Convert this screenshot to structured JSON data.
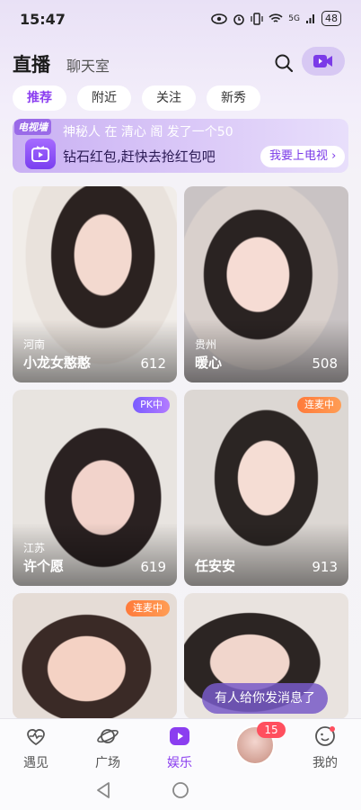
{
  "status_bar": {
    "time": "15:47",
    "battery": "48",
    "signal_label": "5G"
  },
  "header": {
    "title": "直播",
    "tab_chat": "聊天室"
  },
  "chips": [
    {
      "label": "推荐",
      "active": true
    },
    {
      "label": "附近",
      "active": false
    },
    {
      "label": "关注",
      "active": false
    },
    {
      "label": "新秀",
      "active": false
    }
  ],
  "banner": {
    "tag": "电视墙",
    "line1": "神秘人 在 清心 阁 发了一个50",
    "line2": "钻石红包,赶快去抢红包吧",
    "cta": "我要上电视"
  },
  "cards": [
    {
      "region": "河南",
      "name": "小龙女憨憨",
      "count": "612",
      "badge": ""
    },
    {
      "region": "贵州",
      "name": "暖心",
      "count": "508",
      "badge": ""
    },
    {
      "region": "江苏",
      "name": "许个愿",
      "count": "619",
      "badge": "PK中"
    },
    {
      "region": "",
      "name": "任安安",
      "count": "913",
      "badge": "连麦中"
    },
    {
      "region": "",
      "name": "",
      "count": "",
      "badge": "连麦中"
    },
    {
      "region": "",
      "name": "",
      "count": "",
      "badge": ""
    }
  ],
  "toast": "有人给你发消息了",
  "tabbar": {
    "tabs": [
      {
        "label": "遇见",
        "icon": "heart-pulse-icon"
      },
      {
        "label": "广场",
        "icon": "planet-icon"
      },
      {
        "label": "娱乐",
        "icon": "play-icon",
        "active": true
      },
      {
        "label": "我的",
        "icon": "smile-icon"
      }
    ],
    "message_count": "15"
  },
  "colors": {
    "accent": "#8b3ef0",
    "badge_red": "#ff4f5e"
  }
}
